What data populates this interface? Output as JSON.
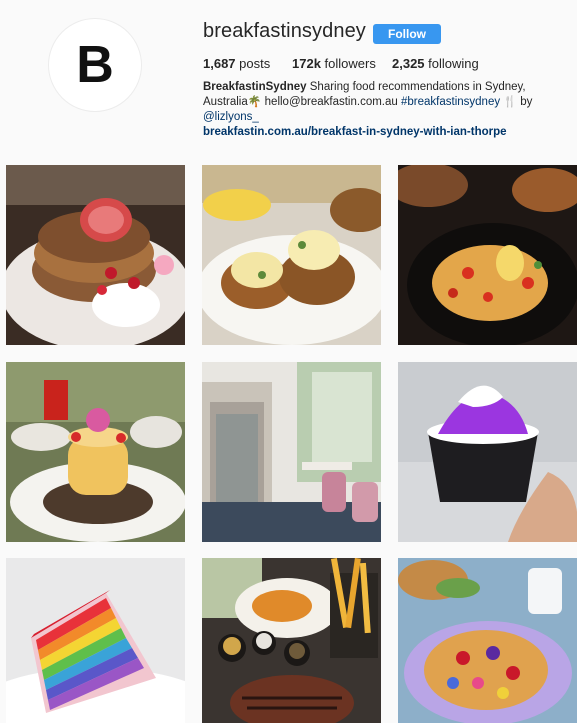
{
  "profile": {
    "avatar_letter": "B",
    "username": "breakfastinsydney",
    "follow_label": "Follow",
    "stats": {
      "posts_count": "1,687",
      "posts_label": "posts",
      "followers_count": "172k",
      "followers_label": "followers",
      "following_count": "2,325",
      "following_label": "following"
    },
    "bio": {
      "name": "BreakfastinSydney",
      "line1": "Sharing food recommendations in Sydney,",
      "line2_start": "Australia",
      "palm_emoji": "🌴",
      "line2_email": "hello@breakfastin.com.au",
      "hashtag": "#breakfastinsydney",
      "fork_emoji": "🍴",
      "by": "by",
      "mention": "@lizlyons_",
      "link": "breakfastin.com.au/breakfast-in-sydney-with-ian-thorpe"
    }
  },
  "grid": {
    "posts": [
      {
        "subject": "pancake-stack-with-strawberries-and-cream"
      },
      {
        "subject": "eggs-benedict-with-fried-chicken"
      },
      {
        "subject": "french-toast-with-strawberries"
      },
      {
        "subject": "souffle-pancakes-with-flower"
      },
      {
        "subject": "mirrored-cafe-interior"
      },
      {
        "subject": "purple-soft-serve-ice-cream"
      },
      {
        "subject": "rainbow-crepe-cake"
      },
      {
        "subject": "steak-and-chips-platter"
      },
      {
        "subject": "waffle-with-berries-and-flowers"
      }
    ]
  },
  "colors": {
    "follow_button": "#3897f0",
    "link": "#003569",
    "background": "#fafafa"
  }
}
